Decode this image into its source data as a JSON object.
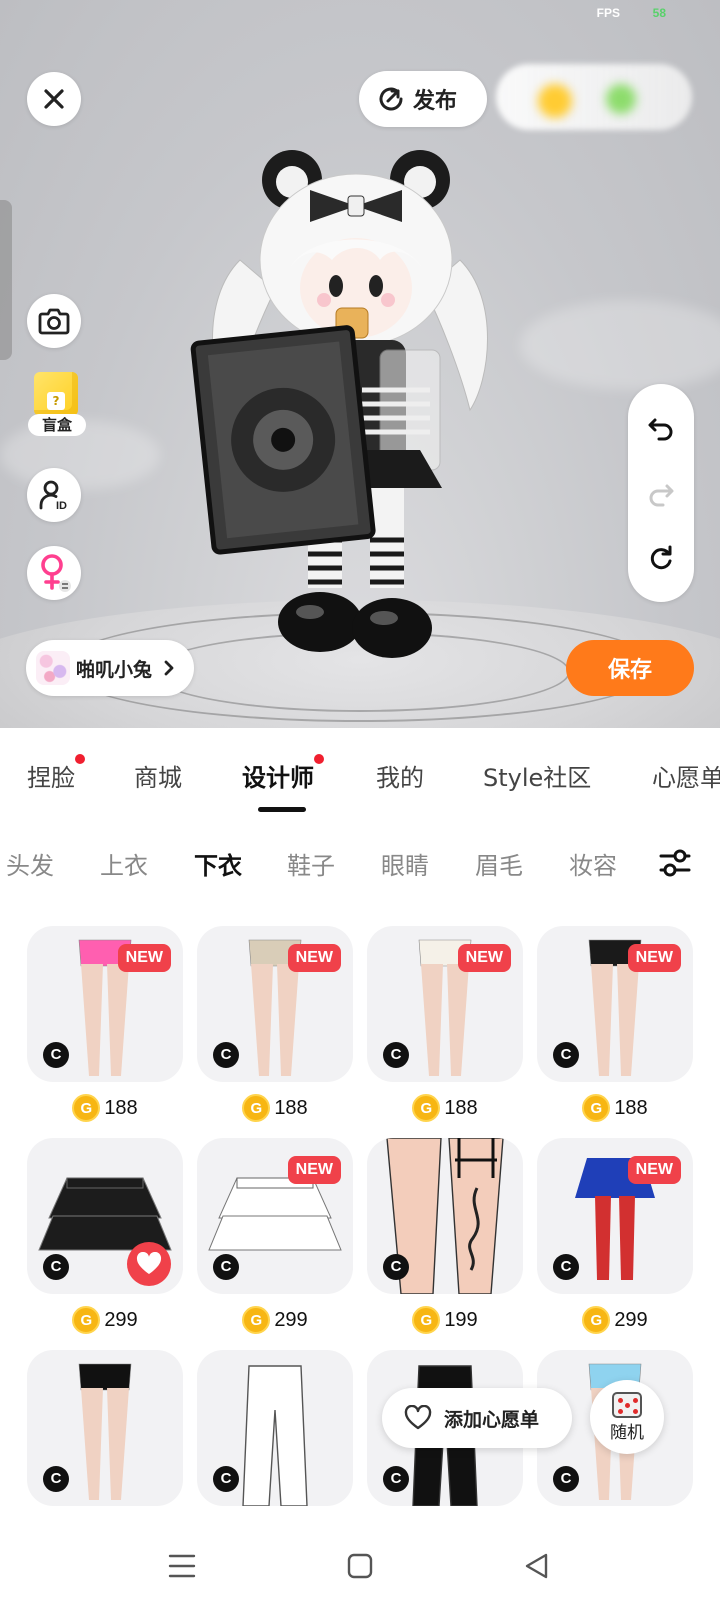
{
  "status": {
    "fps_label": "FPS",
    "fps_value": "58"
  },
  "top": {
    "publish_label": "发布"
  },
  "left_tools": {
    "blindbox_label": "盲盒"
  },
  "character": {
    "name": "啪叽小兔"
  },
  "save_label": "保存",
  "tabs": [
    {
      "label": "捏脸",
      "dot": true
    },
    {
      "label": "商城",
      "dot": false
    },
    {
      "label": "设计师",
      "dot": true,
      "active": true
    },
    {
      "label": "我的",
      "dot": false
    },
    {
      "label": "Style社区",
      "dot": false
    },
    {
      "label": "心愿单",
      "dot": false
    }
  ],
  "categories": [
    {
      "label": "头发"
    },
    {
      "label": "上衣"
    },
    {
      "label": "下衣",
      "active": true
    },
    {
      "label": "鞋子"
    },
    {
      "label": "眼睛"
    },
    {
      "label": "眉毛"
    },
    {
      "label": "妆容"
    }
  ],
  "new_tag": "NEW",
  "c_mark": "C",
  "coin_symbol": "G",
  "items": [
    {
      "kind": "legs",
      "short_color": "#ff5fb0",
      "new": true,
      "price": "188"
    },
    {
      "kind": "legs",
      "short_color": "#d9cdb8",
      "new": true,
      "price": "188"
    },
    {
      "kind": "legs",
      "short_color": "#f5f1e8",
      "new": true,
      "price": "188"
    },
    {
      "kind": "legs",
      "short_color": "#1a1a1a",
      "new": true,
      "price": "188"
    },
    {
      "kind": "skirt",
      "short_color": "#1c1c1c",
      "new": false,
      "liked": true,
      "price": "299"
    },
    {
      "kind": "skirt",
      "short_color": "#ffffff",
      "new": true,
      "price": "299"
    },
    {
      "kind": "tattoo-legs",
      "short_color": "#111111",
      "new": false,
      "price": "199"
    },
    {
      "kind": "pleated",
      "short_color": "#1f3fb8",
      "new": true,
      "price": "299"
    },
    {
      "kind": "legs",
      "short_color": "#111111",
      "new": false,
      "price": ""
    },
    {
      "kind": "pants",
      "short_color": "#ffffff",
      "new": false,
      "price": ""
    },
    {
      "kind": "pants",
      "short_color": "#111111",
      "new": false,
      "price": ""
    },
    {
      "kind": "legs",
      "short_color": "#8fd3ef",
      "new": false,
      "price": ""
    }
  ],
  "wishlist_label": "添加心愿单",
  "random_label": "随机",
  "colors": {
    "accent": "#ff7a1a",
    "badge": "#f0414a",
    "coin": "#f7b613"
  }
}
